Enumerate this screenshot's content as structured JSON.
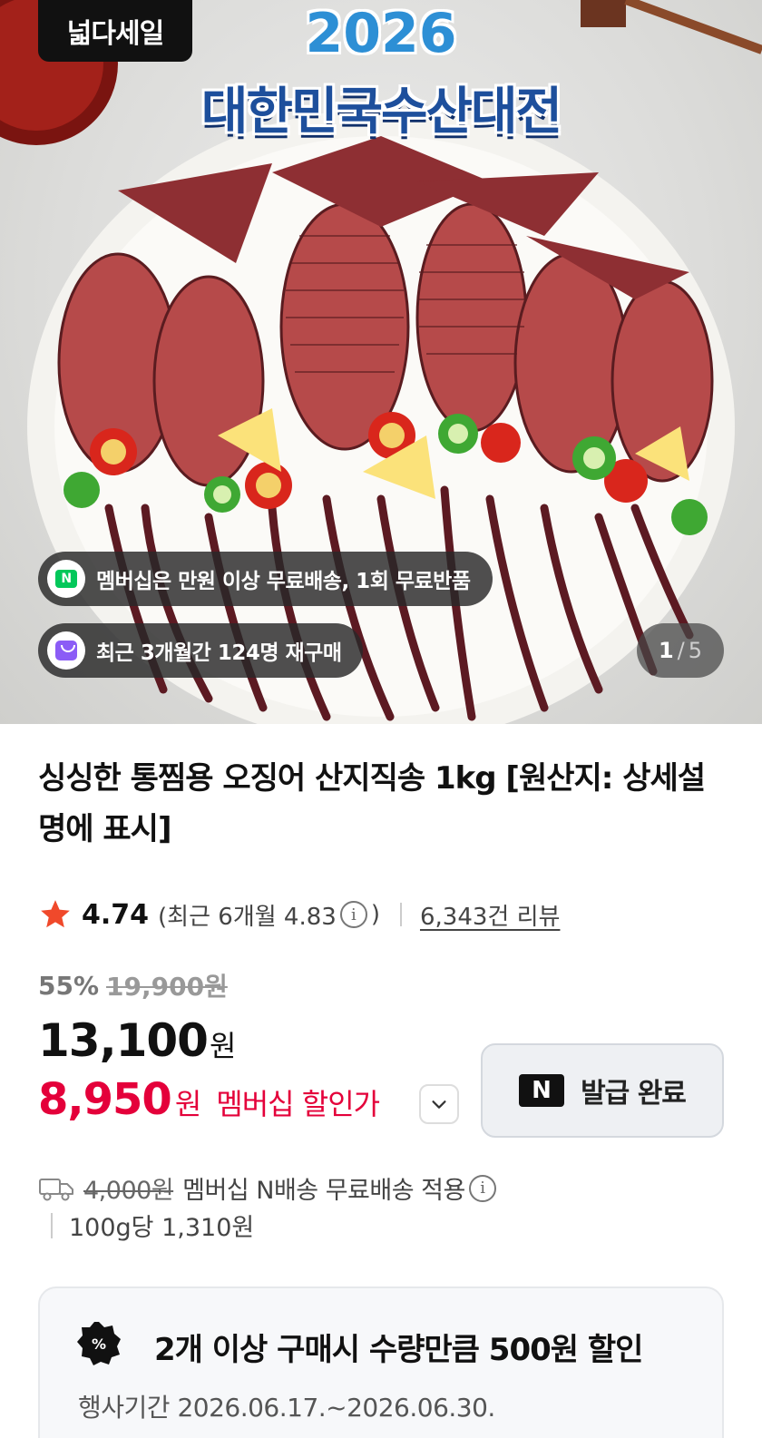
{
  "hero": {
    "brand_badge": "넓다세일",
    "event_year": "2026",
    "event_title": "대한민국수산대전",
    "pill_membership": "멤버십은 만원 이상 무료배송, 1회 무료반품",
    "pill_repurchase": "최근 3개월간 124명 재구매",
    "image_counter": {
      "current": "1",
      "separator": "/",
      "total": "5"
    },
    "icons": {
      "membership": "n-delivery-icon",
      "repurchase": "shopping-bag-icon"
    }
  },
  "product": {
    "title": "싱싱한 통찜용 오징어 산지직송 1kg [원산지: 상세설명에 표시]",
    "rating": "4.74",
    "recent_rating_text": "(최근 6개월 4.83",
    "recent_rating_close": ")",
    "info_glyph": "i",
    "review_count": "6,343건 리뷰"
  },
  "price": {
    "discount_rate": "55%",
    "original_price": "19,900원",
    "sale_price": "13,100",
    "sale_unit": "원",
    "member_price": "8,950",
    "member_unit": "원",
    "member_label": "멤버십 할인가",
    "coupon_button": {
      "logo": "N",
      "label": "발급 완료"
    }
  },
  "shipping": {
    "original_fee": "4,000원",
    "description": "멤버십 N배송 무료배송 적용",
    "unit_price": "100g당 1,310원"
  },
  "promotion": {
    "badge": "%",
    "text": "2개 이상 구매시 수량만큼 500원 할인",
    "period": "행사기간 2026.06.17.~2026.06.30."
  },
  "colors": {
    "accent_red": "#e4003a",
    "star": "#f0492b",
    "naver_green": "#03c75a"
  }
}
